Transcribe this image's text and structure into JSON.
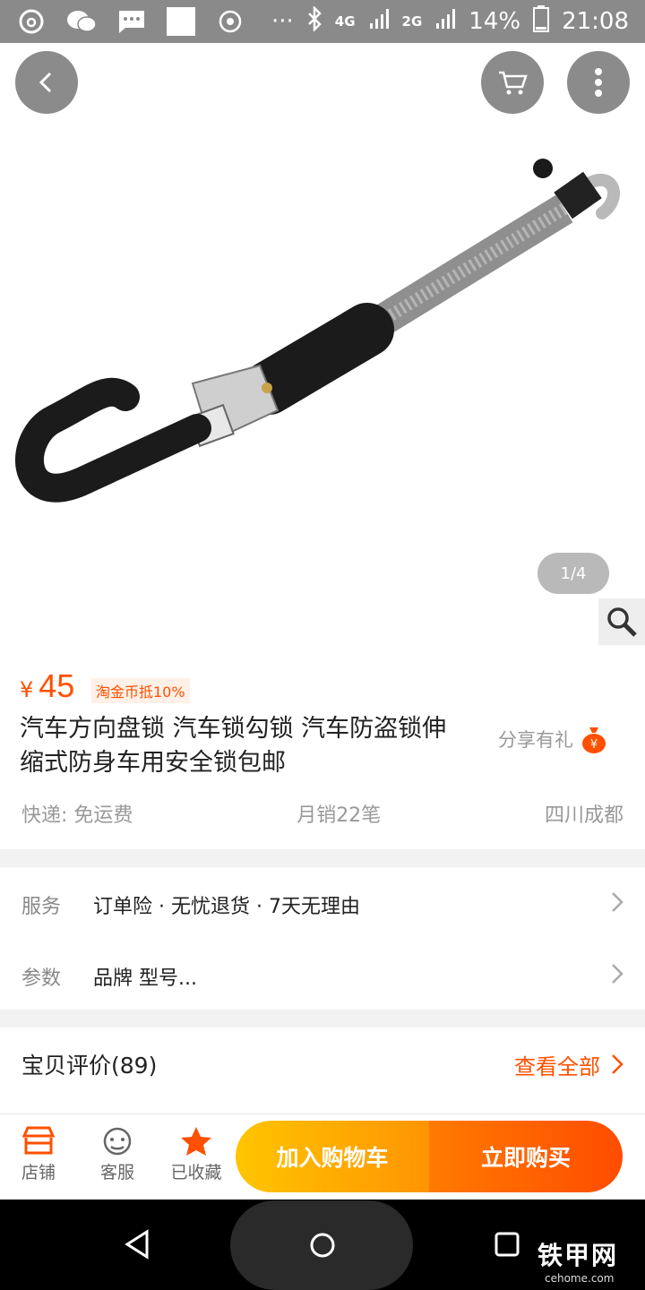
{
  "status_bar": {
    "network": "4G",
    "network2": "2G",
    "battery": "14%",
    "time": "21:08",
    "more": "···"
  },
  "product": {
    "currency": "¥",
    "price": "45",
    "coin_badge": "淘金币抵10%",
    "title": "汽车方向盘锁 汽车锁勾锁 汽车防盗锁伸缩式防身车用安全锁包邮",
    "share_label": "分享有礼",
    "image_index": "1/4",
    "shipping": "快递: 免运费",
    "monthly_sales": "月销22笔",
    "location": "四川成都"
  },
  "service_row": {
    "label": "服务",
    "value": "订单险 · 无忧退货 · 7天无理由"
  },
  "params_row": {
    "label": "参数",
    "value": "品牌 型号..."
  },
  "reviews": {
    "title": "宝贝评价(89)",
    "view_all": "查看全部"
  },
  "bottom_bar": {
    "shop": "店铺",
    "service": "客服",
    "favorited": "已收藏",
    "add_to_cart": "加入购物车",
    "buy_now": "立即购买"
  },
  "watermark": {
    "main": "铁甲网",
    "sub": "cehome.com"
  },
  "colors": {
    "accent": "#ff5000",
    "cart_button": "#ffb300",
    "buy_button": "#ff5a00"
  }
}
